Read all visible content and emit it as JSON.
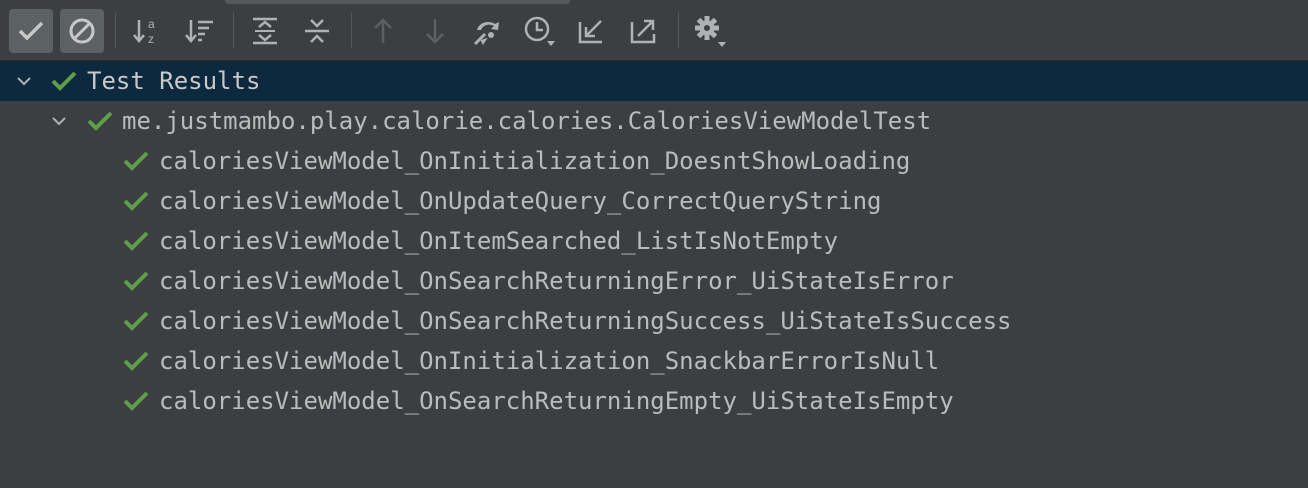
{
  "toolbar": {
    "buttons": [
      {
        "name": "show-passed-button",
        "icon": "check-icon",
        "pressed": true
      },
      {
        "name": "show-ignored-button",
        "icon": "cancel-circle-icon",
        "pressed": true
      },
      {
        "name": "sort-alphabetically-button",
        "icon": "sort-az-icon",
        "pressed": false
      },
      {
        "name": "sort-by-duration-button",
        "icon": "sort-duration-icon",
        "pressed": false
      },
      {
        "name": "expand-all-button",
        "icon": "expand-all-icon",
        "pressed": false
      },
      {
        "name": "collapse-all-button",
        "icon": "collapse-all-icon",
        "pressed": false
      },
      {
        "name": "previous-failed-button",
        "icon": "arrow-up-icon",
        "pressed": false
      },
      {
        "name": "next-failed-button",
        "icon": "arrow-down-icon",
        "pressed": false
      },
      {
        "name": "import-tests-button",
        "icon": "import-icon",
        "pressed": false
      },
      {
        "name": "test-history-button",
        "icon": "clock-icon",
        "pressed": false
      },
      {
        "name": "import-results-button",
        "icon": "arrow-import-icon",
        "pressed": false
      },
      {
        "name": "export-results-button",
        "icon": "arrow-export-icon",
        "pressed": false
      },
      {
        "name": "settings-button",
        "icon": "gear-icon",
        "pressed": false
      }
    ]
  },
  "tree": {
    "root": {
      "label": "Test Results",
      "status": "passed",
      "expanded": true
    },
    "suite": {
      "label": "me.justmambo.play.calorie.calories.CaloriesViewModelTest",
      "status": "passed",
      "expanded": true
    },
    "tests": [
      {
        "label": "caloriesViewModel_OnInitialization_DoesntShowLoading",
        "status": "passed"
      },
      {
        "label": "caloriesViewModel_OnUpdateQuery_CorrectQueryString",
        "status": "passed"
      },
      {
        "label": "caloriesViewModel_OnItemSearched_ListIsNotEmpty",
        "status": "passed"
      },
      {
        "label": "caloriesViewModel_OnSearchReturningError_UiStateIsError",
        "status": "passed"
      },
      {
        "label": "caloriesViewModel_OnSearchReturningSuccess_UiStateIsSuccess",
        "status": "passed"
      },
      {
        "label": "caloriesViewModel_OnInitialization_SnackbarErrorIsNull",
        "status": "passed"
      },
      {
        "label": "caloriesViewModel_OnSearchReturningEmpty_UiStateIsEmpty",
        "status": "passed"
      }
    ]
  },
  "colors": {
    "background": "#3c3f41",
    "selection": "#0d293e",
    "passed": "#5f9e4a",
    "text": "#bbbbbb",
    "icon": "#afb1b3"
  }
}
